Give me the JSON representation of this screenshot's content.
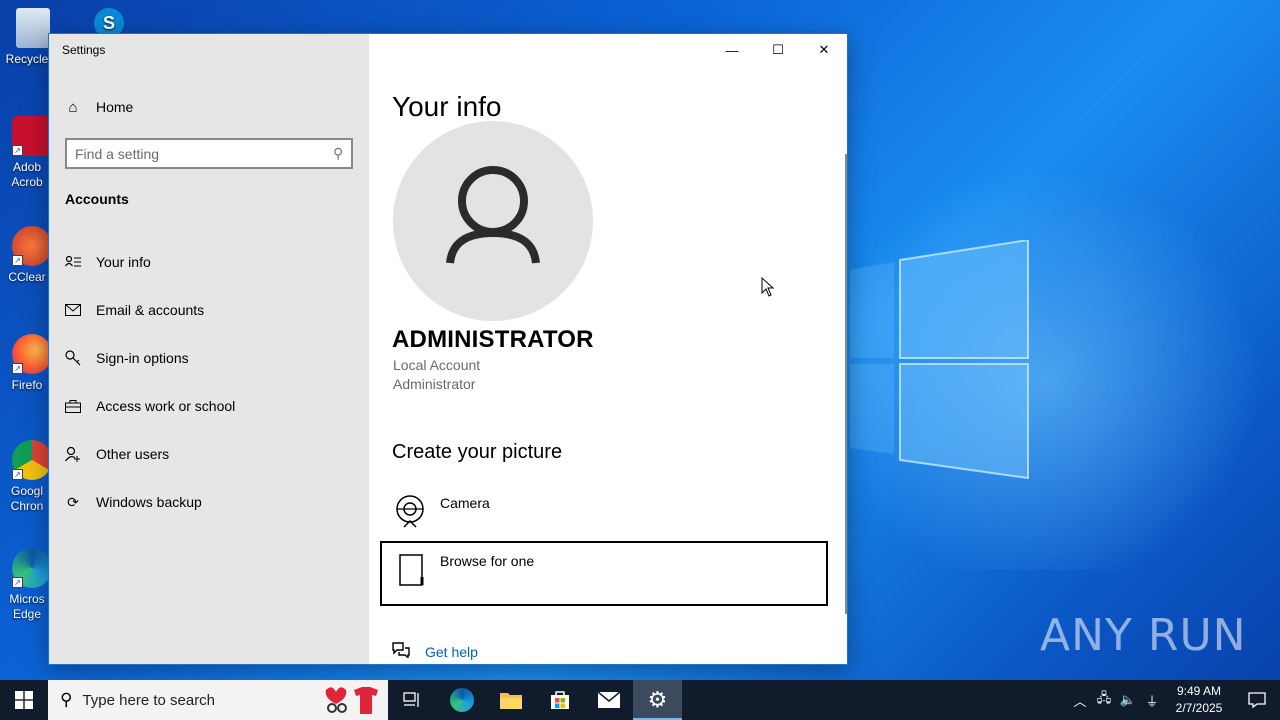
{
  "desktop": {
    "icons": [
      {
        "label": "Recycle",
        "name": "recycle-bin"
      },
      {
        "label": "Adob Acrob",
        "name": "adobe-acrobat"
      },
      {
        "label": "CClear",
        "name": "ccleaner"
      },
      {
        "label": "Firefo",
        "name": "firefox"
      },
      {
        "label": "Googl Chron",
        "name": "google-chrome"
      },
      {
        "label": "Micros Edge",
        "name": "microsoft-edge"
      }
    ],
    "watermark": "ANY RUN"
  },
  "window": {
    "title": "Settings",
    "controls": {
      "minimize": "—",
      "maximize": "☐",
      "close": "✕"
    }
  },
  "sidebar": {
    "home_label": "Home",
    "search_placeholder": "Find a setting",
    "section_title": "Accounts",
    "items": [
      {
        "label": "Your info",
        "icon": "person-card-icon"
      },
      {
        "label": "Email & accounts",
        "icon": "mail-icon"
      },
      {
        "label": "Sign-in options",
        "icon": "key-icon"
      },
      {
        "label": "Access work or school",
        "icon": "briefcase-icon"
      },
      {
        "label": "Other users",
        "icon": "add-person-icon"
      },
      {
        "label": "Windows backup",
        "icon": "sync-icon"
      }
    ]
  },
  "main": {
    "title": "Your info",
    "user_name": "ADMINISTRATOR",
    "account_type": "Local Account",
    "account_role": "Administrator",
    "create_picture_title": "Create your picture",
    "options": [
      {
        "label": "Camera",
        "icon": "camera-icon"
      },
      {
        "label": "Browse for one",
        "icon": "file-icon"
      }
    ],
    "help_label": "Get help"
  },
  "taskbar": {
    "search_placeholder": "Type here to search",
    "time": "9:49 AM",
    "date": "2/7/2025"
  }
}
